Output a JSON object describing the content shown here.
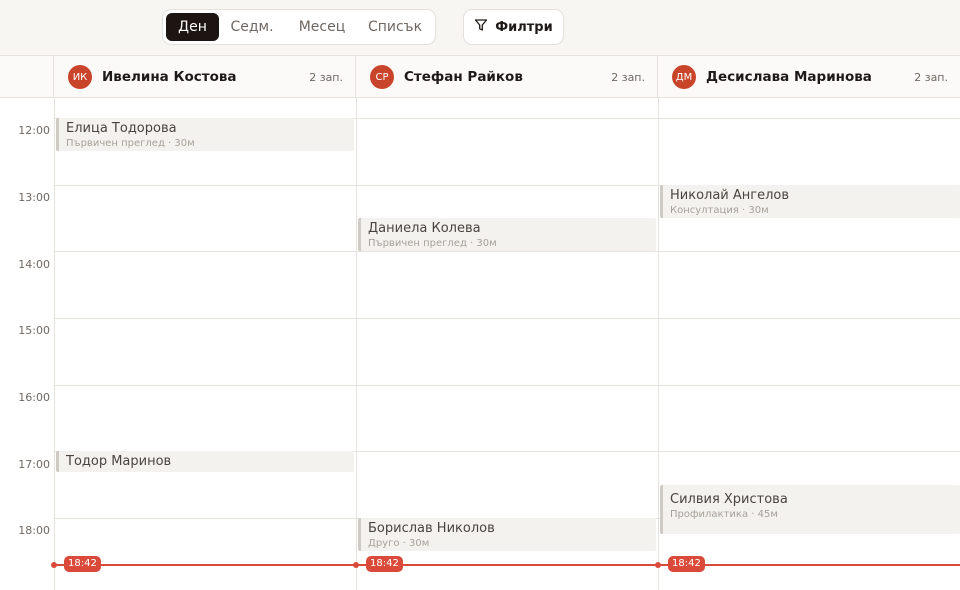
{
  "toolbar": {
    "views": [
      "Ден",
      "Седм.",
      "Месец",
      "Списък"
    ],
    "active_view": "Ден",
    "filter_label": "Филтри"
  },
  "staff": [
    {
      "initials": "ИК",
      "name": "Ивелина Костова",
      "count": "2 зап."
    },
    {
      "initials": "СР",
      "name": "Стефан Райков",
      "count": "2 зап."
    },
    {
      "initials": "ДМ",
      "name": "Десислава Маринова",
      "count": "2 зап."
    }
  ],
  "hours": [
    "12:00",
    "13:00",
    "14:00",
    "15:00",
    "16:00",
    "17:00",
    "18:00"
  ],
  "appointments": [
    {
      "name": "Елица Тодорова",
      "meta": "Първичен преглед · 30м"
    },
    {
      "name": "Тодор Маринов",
      "meta": ""
    },
    {
      "name": "Даниела Колева",
      "meta": "Първичен преглед · 30м"
    },
    {
      "name": "Борислав Николов",
      "meta": "Друго · 30м"
    },
    {
      "name": "Николай Ангелов",
      "meta": "Консултация · 30м"
    },
    {
      "name": "Силвия Христова",
      "meta": "Профилактика · 45м"
    }
  ],
  "now_time": "18:42",
  "colors": {
    "accent": "#c8442a",
    "now": "#d94a3a",
    "active_tab": "#1c1512"
  }
}
